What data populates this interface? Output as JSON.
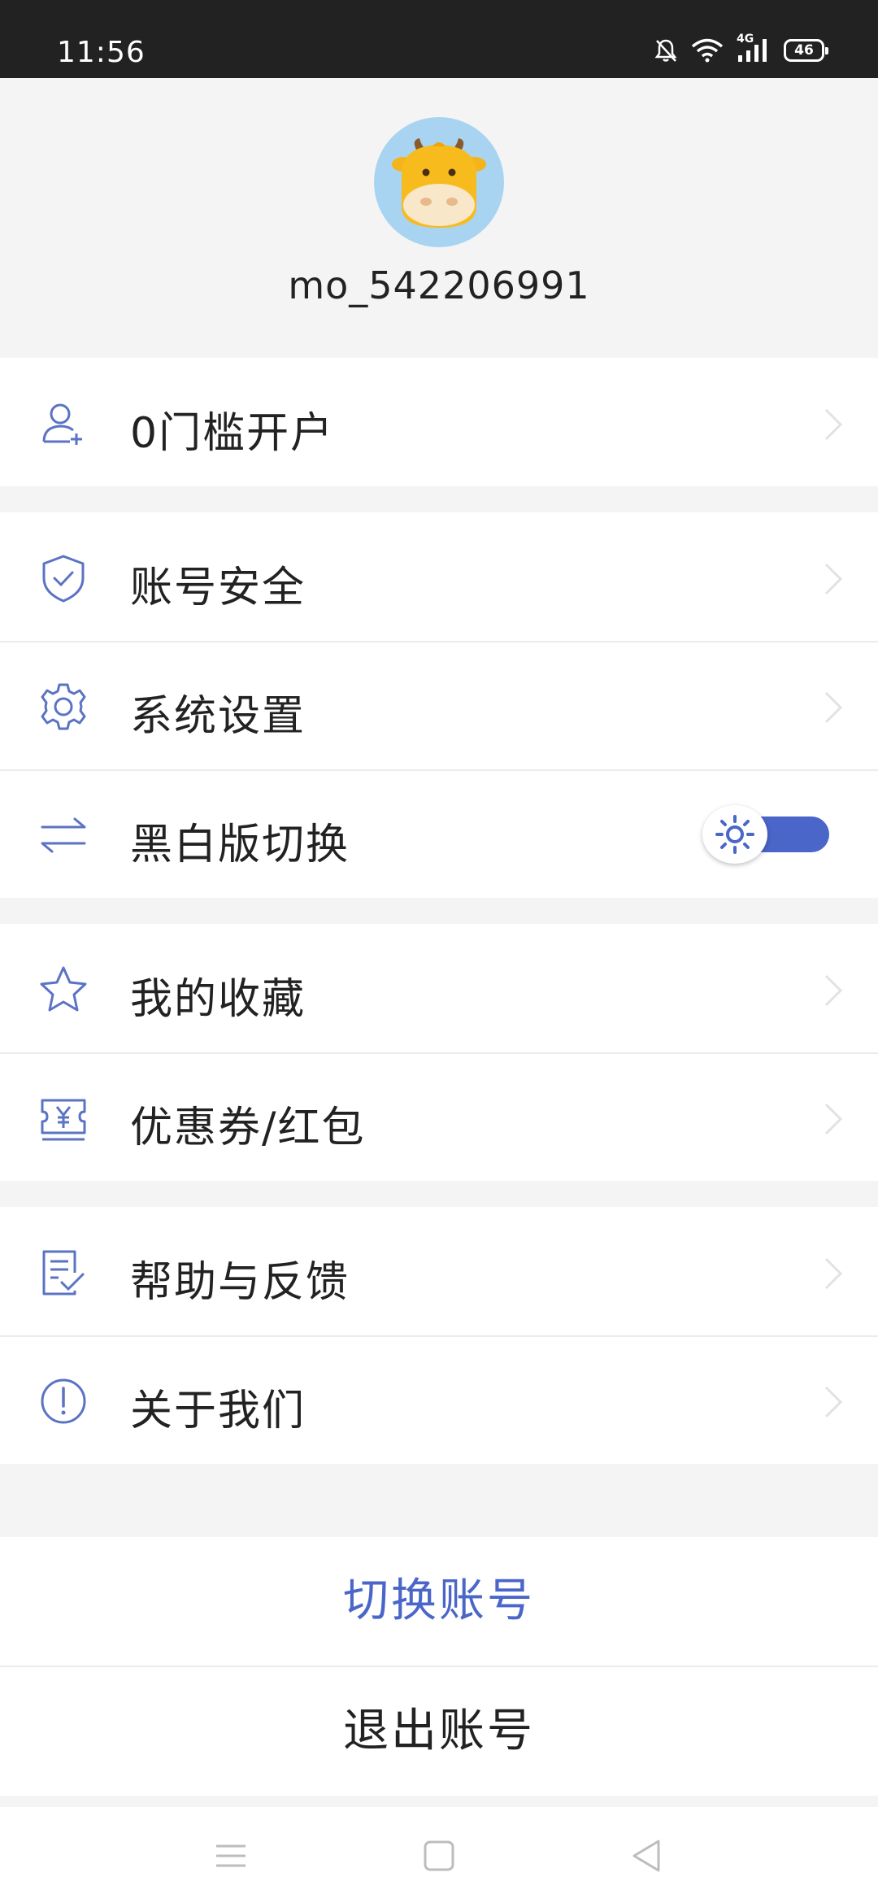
{
  "status_bar": {
    "time": "11:56",
    "network": "4G",
    "battery": "46"
  },
  "profile": {
    "username": "mo_542206991"
  },
  "menu": {
    "open_account": "0门槛开户",
    "account_security": "账号安全",
    "system_settings": "系统设置",
    "mono_toggle": "黑白版切换",
    "favorites": "我的收藏",
    "coupons": "优惠券/红包",
    "help_feedback": "帮助与反馈",
    "about_us": "关于我们"
  },
  "actions": {
    "switch_account": "切换账号",
    "logout": "退出账号"
  },
  "colors": {
    "accent": "#4a66c9",
    "icon": "#5b73c4",
    "chevron": "#e2e2e2",
    "status_bar": "#222222",
    "page_bg": "#f4f4f4"
  },
  "mono_toggle_on": true
}
